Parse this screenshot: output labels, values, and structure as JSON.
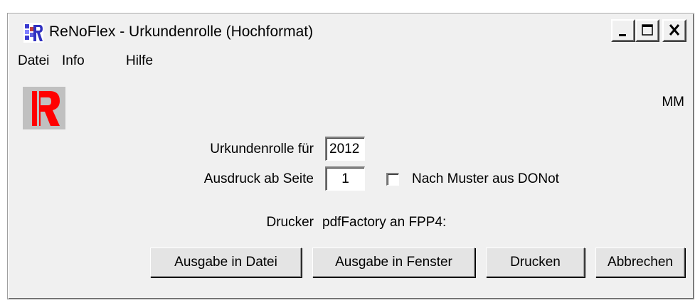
{
  "window": {
    "title": "ReNoFlex - Urkundenrolle (Hochformat)",
    "icon": "renoflex-app-icon",
    "controls": [
      "minimize-icon",
      "maximize-icon",
      "close-icon"
    ]
  },
  "menu": [
    {
      "label": "Datei"
    },
    {
      "label": "Info"
    },
    {
      "label": "Hilfe"
    }
  ],
  "header": {
    "logo_icon": "renoflex-logo",
    "user": "MM"
  },
  "form": {
    "year_label": "Urkundenrolle für",
    "year_value": "2012",
    "page_label": "Ausdruck ab Seite",
    "page_value": "1",
    "pattern_checkbox_label": "Nach Muster aus DONot",
    "pattern_checked": false,
    "printer_label": "Drucker",
    "printer_value": "pdfFactory an FPP4:"
  },
  "buttons": {
    "file_output": "Ausgabe in Datei",
    "window_output": "Ausgabe in Fenster",
    "print": "Drucken",
    "cancel": "Abbrechen"
  },
  "colors": {
    "logo_red": "#ff0000",
    "logo_bg": "#c0c0c0",
    "dialog_bg": "#f0f0f0"
  }
}
